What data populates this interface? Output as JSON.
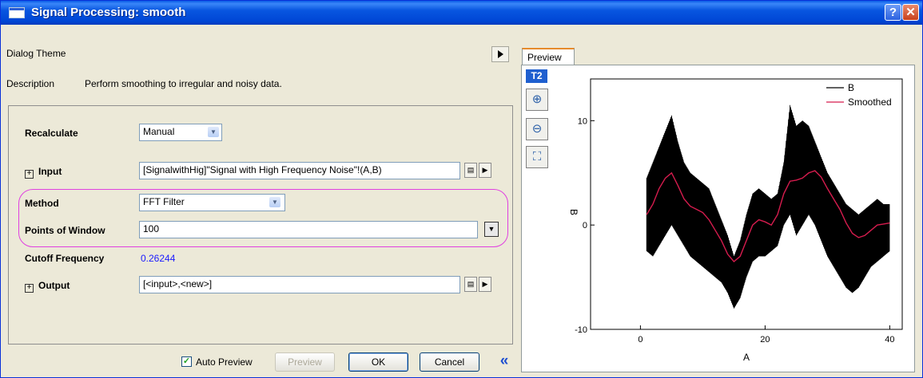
{
  "window": {
    "title": "Signal Processing: smooth",
    "help_label": "?",
    "close_label": "✕"
  },
  "dialog_theme": {
    "label": "Dialog Theme",
    "arrow_icon": "right-triangle-icon"
  },
  "description": {
    "label": "Description",
    "text": "Perform smoothing to irregular and noisy data."
  },
  "form": {
    "recalculate": {
      "label": "Recalculate",
      "value": "Manual"
    },
    "input": {
      "label": "Input",
      "value": "[SignalwithHig]\"Signal with High Frequency Noise\"!(A,B)"
    },
    "method": {
      "label": "Method",
      "value": "FFT Filter"
    },
    "points": {
      "label": "Points of Window",
      "value": "100"
    },
    "cutoff": {
      "label": "Cutoff Frequency",
      "value": "0.26244"
    },
    "output": {
      "label": "Output",
      "value": "[<input>,<new>]"
    },
    "expand_symbol": "⊞"
  },
  "bottom": {
    "auto_preview_label": "Auto Preview",
    "auto_preview_checked": true,
    "preview_label": "Preview",
    "ok_label": "OK",
    "cancel_label": "Cancel",
    "collapse_label": "«"
  },
  "preview_panel": {
    "tab_label": "Preview",
    "graph_badge": "T2",
    "tools": [
      "zoom-in-icon",
      "zoom-out-icon",
      "rescale-icon"
    ]
  },
  "colors": {
    "titlebar": "#0054e3",
    "highlight": "#e040e0",
    "series_b": "#000000",
    "series_smoothed": "#d61c4e",
    "link_value": "#1a1aff"
  },
  "chart_data": {
    "type": "line",
    "xlabel": "A",
    "ylabel": "B",
    "xlim": [
      -8,
      42
    ],
    "ylim": [
      -10,
      14
    ],
    "xticks": [
      0,
      20,
      40
    ],
    "yticks": [
      -10,
      0,
      10
    ],
    "legend_position": "top-right",
    "series": [
      {
        "name": "B",
        "color": "#000000",
        "x": [
          1,
          2,
          3,
          4,
          5,
          6,
          7,
          8,
          9,
          10,
          11,
          12,
          13,
          14,
          15,
          16,
          17,
          18,
          19,
          20,
          21,
          22,
          23,
          24,
          25,
          26,
          27,
          28,
          29,
          30,
          31,
          32,
          33,
          34,
          35,
          36,
          37,
          38,
          39,
          40
        ],
        "upper": [
          4.5,
          6,
          7.5,
          9,
          10.5,
          8,
          6,
          5,
          4.5,
          4,
          3.5,
          2,
          0.5,
          -1,
          -3,
          -1.5,
          1,
          3,
          3.5,
          3,
          2.5,
          3,
          6,
          11.5,
          9.5,
          10,
          9.5,
          8,
          6.5,
          5,
          4,
          3,
          2,
          1.5,
          1,
          1.5,
          2,
          2.5,
          2,
          2
        ],
        "lower": [
          -2.5,
          -3,
          -2,
          -1,
          0,
          -1,
          -2,
          -3,
          -3.5,
          -4,
          -4.5,
          -5,
          -5.5,
          -6.5,
          -8,
          -7,
          -5,
          -3.5,
          -3,
          -3,
          -2.5,
          -2,
          0,
          1,
          -1,
          0,
          1,
          0,
          -1.5,
          -3,
          -4,
          -5,
          -6,
          -6.5,
          -6,
          -5,
          -4,
          -3.5,
          -3,
          -2.5
        ]
      },
      {
        "name": "Smoothed",
        "color": "#d61c4e",
        "x": [
          1,
          2,
          3,
          4,
          5,
          6,
          7,
          8,
          9,
          10,
          11,
          12,
          13,
          14,
          15,
          16,
          17,
          18,
          19,
          20,
          21,
          22,
          23,
          24,
          25,
          26,
          27,
          28,
          29,
          30,
          31,
          32,
          33,
          34,
          35,
          36,
          37,
          38,
          39,
          40
        ],
        "values": [
          1,
          2,
          3.5,
          4.5,
          5,
          3.8,
          2.5,
          1.8,
          1.5,
          1.2,
          0.5,
          -0.5,
          -1.5,
          -2.8,
          -3.5,
          -3,
          -1.5,
          0,
          0.5,
          0.3,
          0,
          1,
          3,
          4.2,
          4.3,
          4.5,
          5,
          5.2,
          4.6,
          3.5,
          2.5,
          1.5,
          0.2,
          -0.8,
          -1.2,
          -1,
          -0.5,
          0,
          0.1,
          0.2
        ]
      }
    ]
  }
}
